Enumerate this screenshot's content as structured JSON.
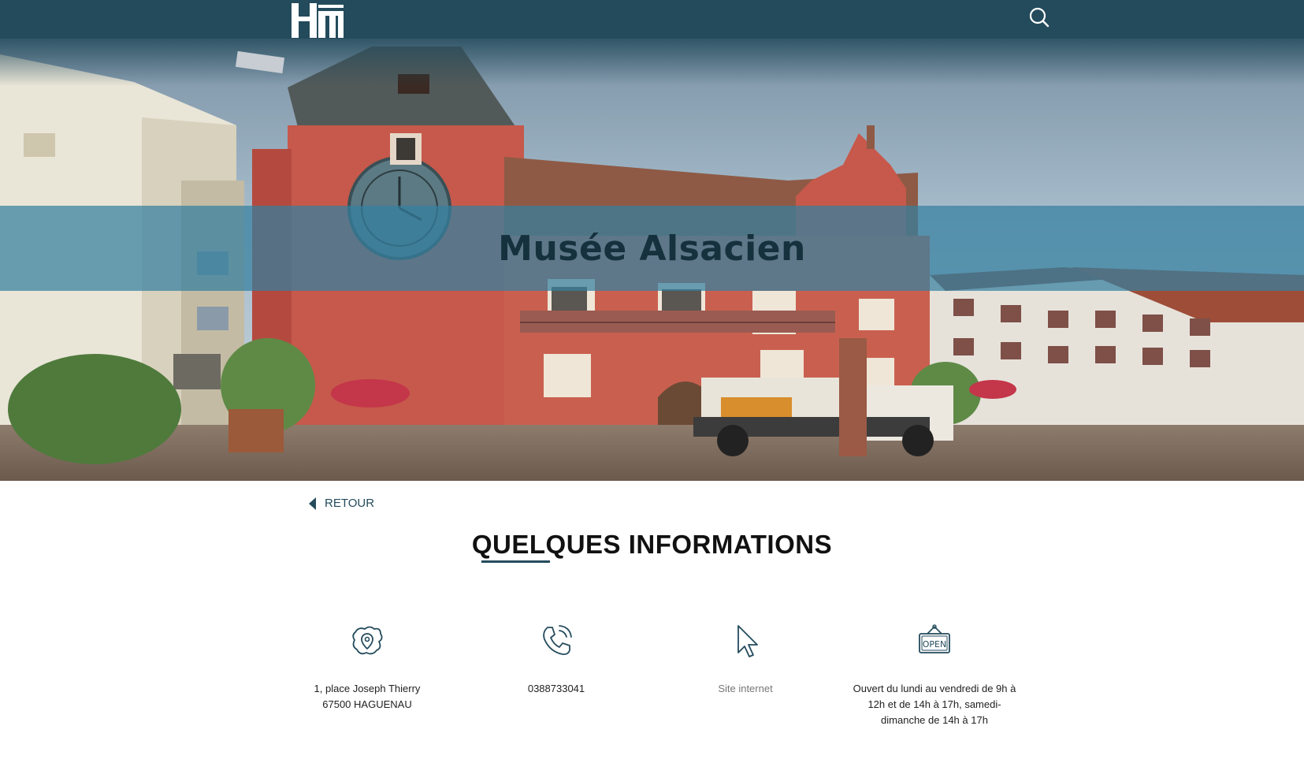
{
  "header": {
    "logo_icon": "hm-logo-icon",
    "search_icon": "search-icon",
    "bg_color": "#244b5c"
  },
  "hero": {
    "title": "Musée Alsacien",
    "band_color": "#3480a0"
  },
  "nav": {
    "back_label": "RETOUR"
  },
  "section": {
    "title": "QUELQUES INFORMATIONS"
  },
  "info": {
    "address": {
      "icon": "map-pin-icon",
      "line1": "1, place Joseph Thierry",
      "line2": "67500 HAGUENAU"
    },
    "phone": {
      "icon": "phone-icon",
      "number": "0388733041"
    },
    "website": {
      "icon": "cursor-icon",
      "label": "Site internet"
    },
    "hours": {
      "icon": "open-sign-icon",
      "line1": "Ouvert du lundi au vendredi de 9h à",
      "line2": "12h et de 14h à 17h, samedi-",
      "line3": "dimanche de 14h à 17h"
    }
  }
}
